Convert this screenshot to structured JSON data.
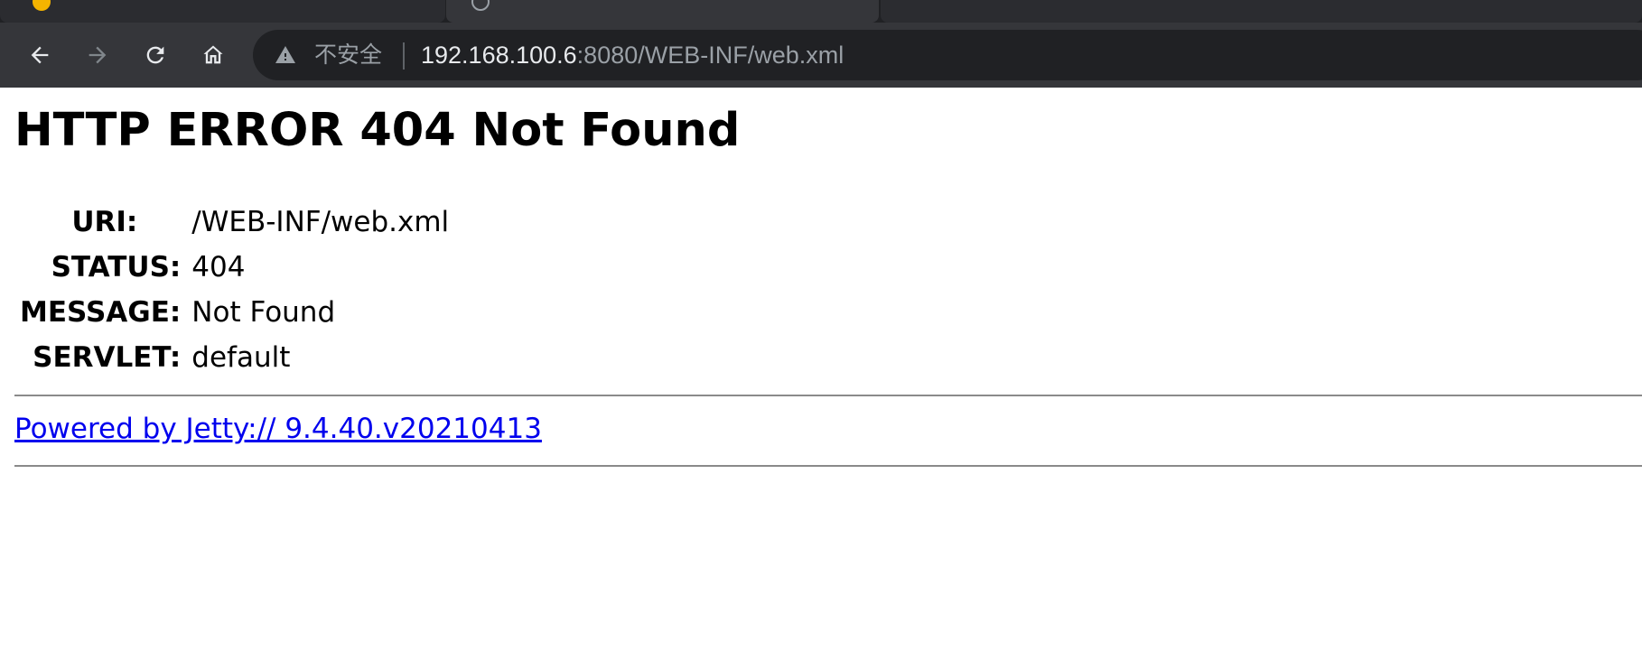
{
  "browser": {
    "security_label": "不安全",
    "url_host": "192.168.100.6",
    "url_rest": ":8080/WEB-INF/web.xml",
    "icons": {
      "back": "back-arrow-icon",
      "forward": "forward-arrow-icon",
      "reload": "reload-icon",
      "home": "home-icon",
      "warning": "warning-triangle-icon"
    },
    "colors": {
      "chrome_bg": "#202124",
      "toolbar_bg": "#35363a",
      "url_host": "#e8eaed",
      "url_path": "#9aa0a6"
    }
  },
  "page": {
    "title": "HTTP ERROR 404 Not Found",
    "rows": [
      {
        "key": "URI:",
        "value": "/WEB-INF/web.xml"
      },
      {
        "key": "STATUS:",
        "value": "404"
      },
      {
        "key": "MESSAGE:",
        "value": "Not Found"
      },
      {
        "key": "SERVLET:",
        "value": "default"
      }
    ],
    "footer_link": "Powered by Jetty:// 9.4.40.v20210413",
    "link_color": "#0000ee"
  }
}
